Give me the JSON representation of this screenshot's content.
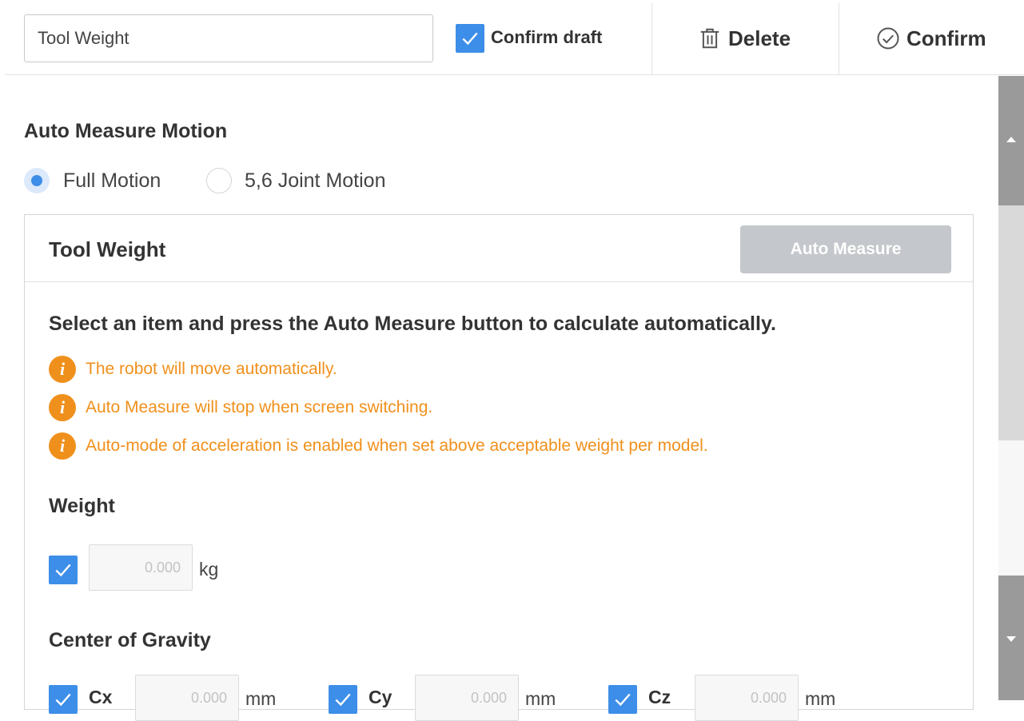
{
  "header": {
    "name_value": "Tool Weight",
    "confirm_draft_label": "Confirm draft",
    "confirm_draft_checked": true,
    "delete_label": "Delete",
    "confirm_label": "Confirm"
  },
  "auto_measure_motion": {
    "title": "Auto Measure Motion",
    "options": [
      {
        "label": "Full Motion",
        "selected": true
      },
      {
        "label": "5,6 Joint Motion",
        "selected": false
      }
    ]
  },
  "panel": {
    "title": "Tool Weight",
    "auto_measure_button": "Auto Measure",
    "instruction": "Select an item and press the Auto Measure button to calculate automatically.",
    "warnings": [
      "The robot will move automatically.",
      "Auto Measure will stop when screen switching.",
      "Auto-mode of acceleration is enabled when set above acceptable weight per model."
    ],
    "weight": {
      "title": "Weight",
      "checked": true,
      "value": "0.000",
      "unit": "kg"
    },
    "center_of_gravity": {
      "title": "Center of Gravity",
      "axes": [
        {
          "label": "Cx",
          "value": "0.000",
          "unit": "mm",
          "checked": true
        },
        {
          "label": "Cy",
          "value": "0.000",
          "unit": "mm",
          "checked": true
        },
        {
          "label": "Cz",
          "value": "0.000",
          "unit": "mm",
          "checked": true
        }
      ]
    }
  },
  "colors": {
    "accent": "#3d8ee8",
    "warning": "#f0901c",
    "disabled_button": "#c4c7cb"
  }
}
